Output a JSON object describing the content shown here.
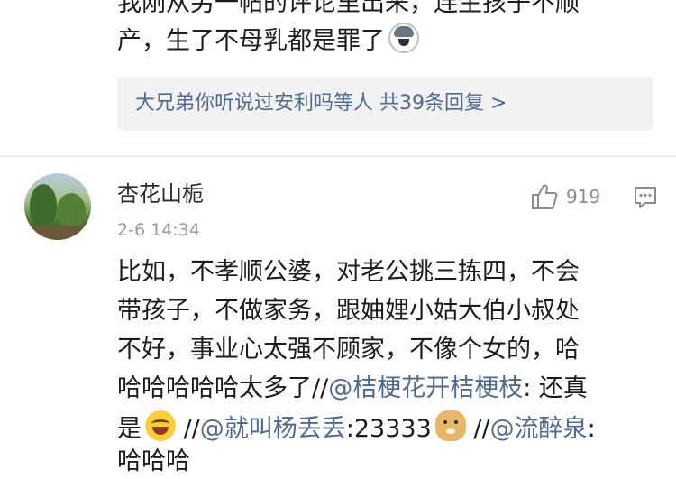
{
  "previous_comment": {
    "line1": "我刚从另一帖的评论里出来，连生孩子不顺",
    "line2": "产，生了不母乳都是罪了",
    "line2_emoji": "husky-emoji",
    "reply_summary": "大兄弟你听说过安利吗等人  共39条回复 >"
  },
  "comment": {
    "username": "杏花山栀",
    "timestamp": "2-6 14:34",
    "like_count": "919",
    "lines": [
      "比如，不孝顺公婆，对老公挑三拣四，不会",
      "带孩子，不做家务，跟妯娌小姑大伯小叔处",
      "不好，事业心太强不顾家，不像个女的，哈"
    ],
    "line4_text": "哈哈哈哈哈太多了",
    "line4_sep": "//",
    "line4_mention": "@桔梗花开桔梗枝",
    "line4_tail": ": 还真",
    "line5_start": "是",
    "line5_sep1": " //",
    "line5_mention1": "@就叫杨丢丢",
    "line5_text1": ":23333",
    "line5_sep2": " //",
    "line5_mention2": "@流醉泉",
    "line5_tail": ":",
    "line6": "哈哈哈"
  },
  "colors": {
    "link": "#4f6a8f",
    "muted": "#9a9a9a",
    "reply_bg": "#f2f2f2"
  },
  "icons": [
    "husky-emoji",
    "avatar",
    "thumbs-up-icon",
    "comment-icon",
    "laughing-emoji",
    "doge-emoji"
  ]
}
